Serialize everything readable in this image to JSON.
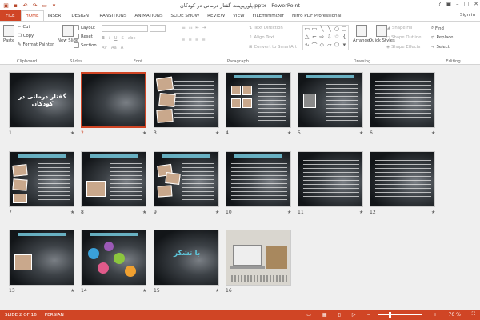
{
  "window": {
    "title": "پاورپوینت گفتار درمانی در کودکان.pptx - PowerPoint",
    "signin": "Sign in"
  },
  "tabs": [
    "FILE",
    "HOME",
    "INSERT",
    "DESIGN",
    "TRANSITIONS",
    "ANIMATIONS",
    "SLIDE SHOW",
    "REVIEW",
    "VIEW",
    "FILEminimizer",
    "Nitro PDF Professional"
  ],
  "active_tab": "HOME",
  "ribbon": {
    "clipboard": {
      "paste": "Paste",
      "cut": "Cut",
      "copy": "Copy",
      "format_painter": "Format Painter",
      "label": "Clipboard"
    },
    "slides": {
      "new_slide": "New Slide",
      "layout": "Layout",
      "reset": "Reset",
      "section": "Section",
      "label": "Slides"
    },
    "font": {
      "label": "Font"
    },
    "paragraph": {
      "text_direction": "Text Direction",
      "align_text": "Align Text",
      "smartart": "Convert to SmartArt",
      "label": "Paragraph"
    },
    "drawing": {
      "arrange": "Arrange",
      "quick_styles": "Quick Styles",
      "shape_fill": "Shape Fill",
      "shape_outline": "Shape Outline",
      "shape_effects": "Shape Effects",
      "label": "Drawing"
    },
    "editing": {
      "find": "Find",
      "replace": "Replace",
      "select": "Select",
      "label": "Editing"
    }
  },
  "slides": [
    {
      "n": "1",
      "title": "گفتار درمانی در کودکان"
    },
    {
      "n": "2"
    },
    {
      "n": "3"
    },
    {
      "n": "4"
    },
    {
      "n": "5"
    },
    {
      "n": "6"
    },
    {
      "n": "7"
    },
    {
      "n": "8"
    },
    {
      "n": "9"
    },
    {
      "n": "10"
    },
    {
      "n": "11"
    },
    {
      "n": "12"
    },
    {
      "n": "13"
    },
    {
      "n": "14"
    },
    {
      "n": "15",
      "title": "با تشکر"
    },
    {
      "n": "16"
    }
  ],
  "selected_slide": "2",
  "status": {
    "slide_info": "SLIDE 2 OF 16",
    "language": "PERSIAN",
    "zoom": "70 %"
  },
  "colors": {
    "accent": "#d04525"
  }
}
